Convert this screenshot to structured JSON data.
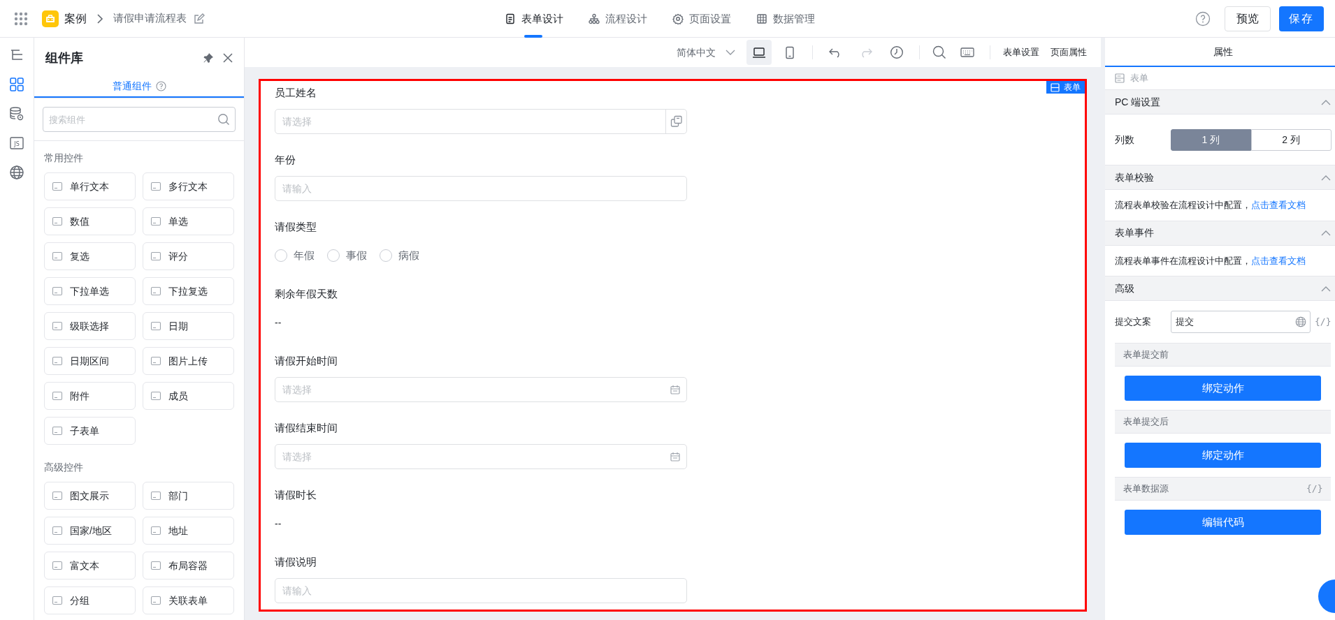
{
  "header": {
    "app_name": "案例",
    "breadcrumb": "请假申请流程表",
    "nav_tabs": [
      {
        "label": "表单设计",
        "selected": true
      },
      {
        "label": "流程设计",
        "selected": false
      },
      {
        "label": "页面设置",
        "selected": false
      },
      {
        "label": "数据管理",
        "selected": false
      }
    ],
    "preview_button": "预览",
    "save_button": "保存"
  },
  "rail": {
    "items": [
      {
        "selected": false
      },
      {
        "selected": true
      },
      {
        "selected": false
      },
      {
        "selected": false,
        "label": "JS"
      },
      {
        "selected": false
      }
    ]
  },
  "component_panel": {
    "title": "组件库",
    "tabs": [
      {
        "label": "普通组件",
        "selected": true
      }
    ],
    "search": {
      "placeholder": "搜索组件"
    },
    "groups": [
      {
        "title": "常用控件",
        "items": [
          {
            "label": "单行文本"
          },
          {
            "label": "多行文本"
          },
          {
            "label": "数值"
          },
          {
            "label": "单选"
          },
          {
            "label": "复选"
          },
          {
            "label": "评分"
          },
          {
            "label": "下拉单选"
          },
          {
            "label": "下拉复选"
          },
          {
            "label": "级联选择"
          },
          {
            "label": "日期"
          },
          {
            "label": "日期区间"
          },
          {
            "label": "图片上传"
          },
          {
            "label": "附件"
          },
          {
            "label": "成员"
          },
          {
            "label": "子表单"
          }
        ]
      },
      {
        "title": "高级控件",
        "items": [
          {
            "label": "图文展示"
          },
          {
            "label": "部门"
          },
          {
            "label": "国家/地区"
          },
          {
            "label": "地址"
          },
          {
            "label": "富文本"
          },
          {
            "label": "布局容器"
          },
          {
            "label": "分组"
          },
          {
            "label": "关联表单"
          }
        ]
      }
    ]
  },
  "canvas_toolbar": {
    "language": "简体中文",
    "devices": [
      {
        "selected": true
      },
      {
        "selected": false
      }
    ],
    "links": [
      "表单设置",
      "页面属性"
    ]
  },
  "form": {
    "badge": "表单",
    "fields": [
      {
        "kind": "picker",
        "label": "员工姓名",
        "placeholder": "请选择"
      },
      {
        "kind": "input",
        "label": "年份",
        "placeholder": "请输入"
      },
      {
        "kind": "radio",
        "label": "请假类型",
        "options": [
          {
            "label": "年假",
            "selected": false
          },
          {
            "label": "事假",
            "selected": false
          },
          {
            "label": "病假",
            "selected": false
          }
        ]
      },
      {
        "kind": "text",
        "label": "剩余年假天数",
        "value": "--"
      },
      {
        "kind": "date",
        "label": "请假开始时间",
        "placeholder": "请选择"
      },
      {
        "kind": "date",
        "label": "请假结束时间",
        "placeholder": "请选择"
      },
      {
        "kind": "text",
        "label": "请假时长",
        "value": "--"
      },
      {
        "kind": "input",
        "label": "请假说明",
        "placeholder": "请输入"
      }
    ]
  },
  "properties_panel": {
    "tabs": [
      {
        "label": "属性",
        "selected": true
      }
    ],
    "breadcrumb": "表单",
    "sections": [
      {
        "kind": "columns",
        "title": "PC 端设置",
        "expanded": true,
        "label": "列数",
        "options": [
          {
            "label": "1 列",
            "selected": true
          },
          {
            "label": "2 列",
            "selected": false
          }
        ]
      },
      {
        "kind": "note",
        "title": "表单校验",
        "expanded": true,
        "text": "流程表单校验在流程设计中配置，",
        "link": "点击查看文档"
      },
      {
        "kind": "note",
        "title": "表单事件",
        "expanded": true,
        "text": "流程表单事件在流程设计中配置，",
        "link": "点击查看文档"
      },
      {
        "kind": "advanced",
        "title": "高级",
        "expanded": true,
        "submit_label": "提交文案",
        "submit_value": "提交",
        "code_mark": "{/}",
        "subsections": [
          {
            "title": "表单提交前",
            "button": "绑定动作"
          },
          {
            "title": "表单提交后",
            "button": "绑定动作"
          },
          {
            "title": "表单数据源",
            "code_mark": "{/}",
            "button": "编辑代码"
          }
        ]
      }
    ]
  }
}
